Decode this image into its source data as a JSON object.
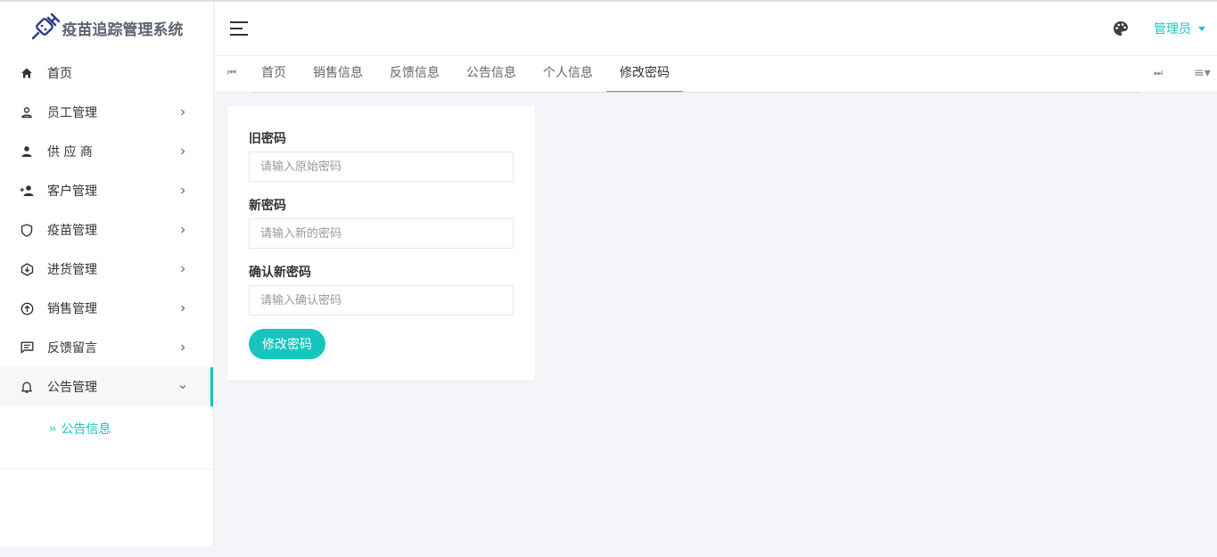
{
  "app": {
    "title": "疫苗追踪管理系统"
  },
  "sidebar": {
    "items": [
      {
        "label": "首页",
        "icon": "home-icon",
        "has_children": false
      },
      {
        "label": "员工管理",
        "icon": "person-outline-icon",
        "has_children": true
      },
      {
        "label": "供 应 商",
        "icon": "person-icon",
        "has_children": true
      },
      {
        "label": "客户管理",
        "icon": "person-add-icon",
        "has_children": true
      },
      {
        "label": "疫苗管理",
        "icon": "shield-icon",
        "has_children": true
      },
      {
        "label": "进货管理",
        "icon": "download-box-icon",
        "has_children": true
      },
      {
        "label": "销售管理",
        "icon": "upload-circle-icon",
        "has_children": true
      },
      {
        "label": "反馈留言",
        "icon": "message-icon",
        "has_children": true
      },
      {
        "label": "公告管理",
        "icon": "bell-icon",
        "has_children": true,
        "expanded": true
      }
    ],
    "submenu": [
      {
        "label": "公告信息",
        "active": true
      }
    ],
    "accent_color": "#16c6be"
  },
  "header": {
    "user_label": "管理员",
    "palette_icon": "palette-icon",
    "menu_icon": "hamburger-icon"
  },
  "tabs": {
    "items": [
      {
        "label": "首页",
        "active": false
      },
      {
        "label": "销售信息",
        "active": false
      },
      {
        "label": "反馈信息",
        "active": false
      },
      {
        "label": "公告信息",
        "active": false
      },
      {
        "label": "个人信息",
        "active": false
      },
      {
        "label": "修改密码",
        "active": true
      }
    ],
    "prev_glyph": "⏮",
    "next_glyph": "⏭",
    "more_glyph": "≡▾"
  },
  "form": {
    "old_password": {
      "label": "旧密码",
      "placeholder": "请输入原始密码",
      "value": ""
    },
    "new_password": {
      "label": "新密码",
      "placeholder": "请输入新的密码",
      "value": ""
    },
    "confirm_password": {
      "label": "确认新密码",
      "placeholder": "请输入确认密码",
      "value": ""
    },
    "submit_label": "修改密码"
  }
}
